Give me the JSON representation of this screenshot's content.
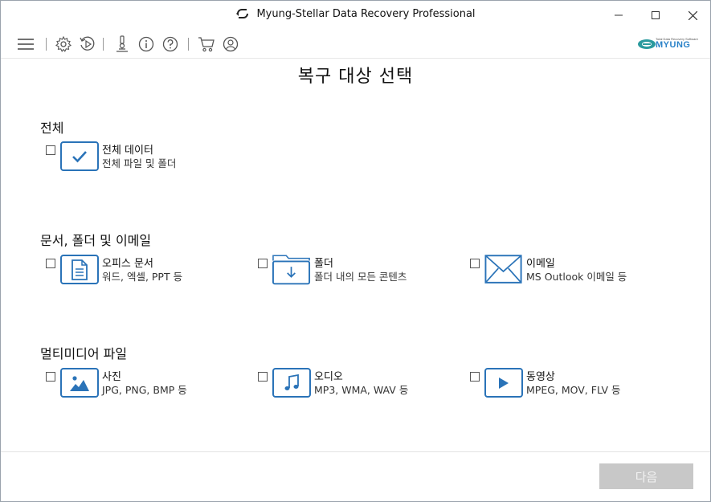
{
  "window": {
    "title": "Myung-Stellar Data Recovery Professional",
    "buttons": [
      "minimize-icon",
      "maximize-icon",
      "close-icon"
    ]
  },
  "toolbar": {
    "icons": [
      "hamburger-menu-icon",
      "settings-icon",
      "history-icon",
      "scan-microscope-icon",
      "info-icon",
      "help-icon",
      "cart-icon",
      "account-icon"
    ],
    "brand": {
      "tagline": "Total Data Recovery Software",
      "name": "MYUNG",
      "color": "#2a82c8"
    }
  },
  "page": {
    "title": "복구 대상 선택"
  },
  "sections": [
    {
      "title": "전체",
      "items": [
        {
          "name": "전체 데이터",
          "desc": "전체 파일 및 폴더",
          "icon": "checkmark-icon"
        }
      ]
    },
    {
      "title": "문서, 폴더 및 이메일",
      "items": [
        {
          "name": "오피스 문서",
          "desc": "워드, 엑셀, PPT 등",
          "icon": "document-icon"
        },
        {
          "name": "폴더",
          "desc": "폴더 내의 모든 콘텐츠",
          "icon": "folder-icon"
        },
        {
          "name": "이메일",
          "desc": "MS Outlook 이메일 등",
          "icon": "envelope-icon"
        }
      ]
    },
    {
      "title": "멀티미디어 파일",
      "items": [
        {
          "name": "사진",
          "desc": "JPG, PNG, BMP 등",
          "icon": "image-icon"
        },
        {
          "name": "오디오",
          "desc": "MP3, WMA, WAV 등",
          "icon": "music-note-icon"
        },
        {
          "name": "동영상",
          "desc": "MPEG, MOV, FLV 등",
          "icon": "play-icon"
        }
      ]
    }
  ],
  "footer": {
    "next_label": "다음",
    "next_enabled": false
  },
  "colors": {
    "accent": "#2a73b8",
    "disabled_button": "#c8c8c8"
  }
}
